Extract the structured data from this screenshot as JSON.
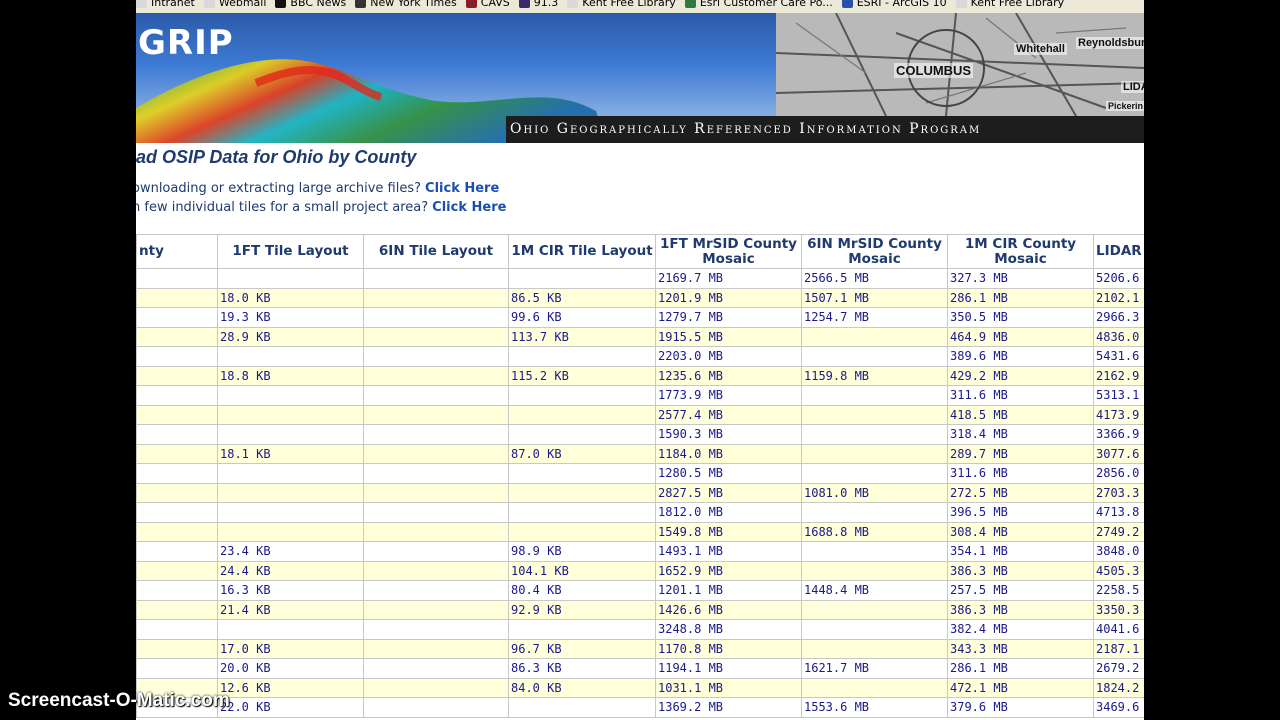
{
  "bookmarks": [
    {
      "label": "Intranet",
      "icon": "page-icon",
      "color": "#d9d9d9"
    },
    {
      "label": "Webmail",
      "icon": "page-icon",
      "color": "#d9d9d9"
    },
    {
      "label": "BBC News",
      "icon": "bbc-icon",
      "color": "#111111"
    },
    {
      "label": "New York Times",
      "icon": "nyt-icon",
      "color": "#333333"
    },
    {
      "label": "CAVS",
      "icon": "cavs-icon",
      "color": "#8a1c2c"
    },
    {
      "label": "91.3",
      "icon": "radio-icon",
      "color": "#3a2a6a"
    },
    {
      "label": "Kent Free Library",
      "icon": "page-icon",
      "color": "#d9d9d9"
    },
    {
      "label": "Esri Customer Care Po...",
      "icon": "globe-icon",
      "color": "#2f7a3a"
    },
    {
      "label": "ESRI - ArcGIS 10",
      "icon": "esri-icon",
      "color": "#2a4fa8"
    },
    {
      "label": "Kent Free Library",
      "icon": "page-icon",
      "color": "#d9d9d9"
    }
  ],
  "banner": {
    "logo": "GRIP",
    "tagline": "Ohio Geographically Referenced Information Program",
    "map_labels": [
      "Whitehall",
      "Reynoldsburg",
      "COLUMBUS",
      "LIDA",
      "Pickerin"
    ]
  },
  "page": {
    "title": "ad OSIP Data for Ohio by County",
    "intro": [
      {
        "text": "ownloading or extracting large archive files?",
        "link": "Click Here"
      },
      {
        "text": "n few individual tiles for a small project area?",
        "link": "Click Here"
      }
    ]
  },
  "table": {
    "columns": [
      "nty",
      "1FT Tile Layout",
      "6IN Tile Layout",
      "1M CIR Tile Layout",
      "1FT MrSID County Mosaic",
      "6IN MrSID County Mosaic",
      "1M CIR County Mosaic",
      "LIDAR"
    ],
    "rows": [
      [
        "",
        "",
        "",
        "",
        "2169.7 MB",
        "2566.5 MB",
        "327.3 MB",
        "5206.6"
      ],
      [
        "",
        "18.0 KB",
        "",
        "86.5 KB",
        "1201.9 MB",
        "1507.1 MB",
        "286.1 MB",
        "2102.1"
      ],
      [
        "",
        "19.3 KB",
        "",
        "99.6 KB",
        "1279.7 MB",
        "1254.7 MB",
        "350.5 MB",
        "2966.3"
      ],
      [
        "",
        "28.9 KB",
        "",
        "113.7 KB",
        "1915.5 MB",
        "",
        "464.9 MB",
        "4836.0"
      ],
      [
        "",
        "",
        "",
        "",
        "2203.0 MB",
        "",
        "389.6 MB",
        "5431.6"
      ],
      [
        "",
        "18.8 KB",
        "",
        "115.2 KB",
        "1235.6 MB",
        "1159.8 MB",
        "429.2 MB",
        "2162.9"
      ],
      [
        "",
        "",
        "",
        "",
        "1773.9 MB",
        "",
        "311.6 MB",
        "5313.1"
      ],
      [
        "",
        "",
        "",
        "",
        "2577.4 MB",
        "",
        "418.5 MB",
        "4173.9"
      ],
      [
        "",
        "",
        "",
        "",
        "1590.3 MB",
        "",
        "318.4 MB",
        "3366.9"
      ],
      [
        "",
        "18.1 KB",
        "",
        "87.0 KB",
        "1184.0 MB",
        "",
        "289.7 MB",
        "3077.6"
      ],
      [
        "",
        "",
        "",
        "",
        "1280.5 MB",
        "",
        "311.6 MB",
        "2856.0"
      ],
      [
        "",
        "",
        "",
        "",
        "2827.5 MB",
        "1081.0 MB",
        "272.5 MB",
        "2703.3"
      ],
      [
        "",
        "",
        "",
        "",
        "1812.0 MB",
        "",
        "396.5 MB",
        "4713.8"
      ],
      [
        "",
        "",
        "",
        "",
        "1549.8 MB",
        "1688.8 MB",
        "308.4 MB",
        "2749.2"
      ],
      [
        "",
        "23.4 KB",
        "",
        "98.9 KB",
        "1493.1 MB",
        "",
        "354.1 MB",
        "3848.0"
      ],
      [
        "",
        "24.4 KB",
        "",
        "104.1 KB",
        "1652.9 MB",
        "",
        "386.3 MB",
        "4505.3"
      ],
      [
        "",
        "16.3 KB",
        "",
        "80.4 KB",
        "1201.1 MB",
        "1448.4 MB",
        "257.5 MB",
        "2258.5"
      ],
      [
        "",
        "21.4 KB",
        "",
        "92.9 KB",
        "1426.6 MB",
        "",
        "386.3 MB",
        "3350.3"
      ],
      [
        "",
        "",
        "",
        "",
        "3248.8 MB",
        "",
        "382.4 MB",
        "4041.6"
      ],
      [
        "",
        "17.0 KB",
        "",
        "96.7 KB",
        "1170.8 MB",
        "",
        "343.3 MB",
        "2187.1"
      ],
      [
        "",
        "20.0 KB",
        "",
        "86.3 KB",
        "1194.1 MB",
        "1621.7 MB",
        "286.1 MB",
        "2679.2"
      ],
      [
        "",
        "12.6 KB",
        "",
        "84.0 KB",
        "1031.1 MB",
        "",
        "472.1 MB",
        "1824.2"
      ],
      [
        "",
        "22.0 KB",
        "",
        "",
        "1369.2 MB",
        "1553.6 MB",
        "379.6 MB",
        "3469.6"
      ]
    ]
  },
  "watermark": "Screencast-O-Matic.com"
}
